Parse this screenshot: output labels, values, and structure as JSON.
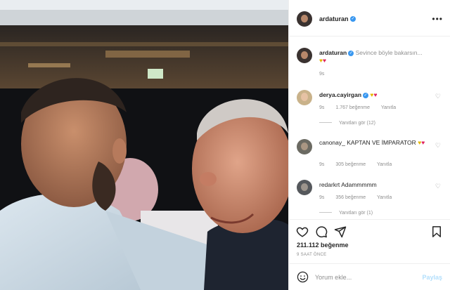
{
  "post": {
    "username": "ardaturan",
    "verified": true,
    "more_icon": "more-horizontal-icon"
  },
  "caption": {
    "username": "ardaturan",
    "text": "Sevince böyle bakarsın...",
    "emojis": [
      "yellow-heart",
      "red-heart"
    ],
    "time": "9s"
  },
  "comments": [
    {
      "username": "derya.cayirgan",
      "verified": true,
      "text": "",
      "emojis": [
        "yellow-heart",
        "red-heart"
      ],
      "time": "9s",
      "likes": "1.767 beğenme",
      "reply": "Yanıtla",
      "view_replies": "Yanıtları gör (12)"
    },
    {
      "username": "canonay_",
      "verified": false,
      "text": "KAPTAN VE İMPARATOR",
      "emojis": [
        "yellow-heart",
        "red-heart"
      ],
      "time": "9s",
      "likes": "305 beğenme",
      "reply": "Yanıtla",
      "view_replies": ""
    },
    {
      "username": "redarkrt",
      "verified": false,
      "text": "Adammmmm",
      "emojis": [],
      "time": "9s",
      "likes": "356 beğenme",
      "reply": "Yanıtla",
      "view_replies": "Yanıtları gör (1)"
    }
  ],
  "actions": {
    "like_icon": "heart-icon",
    "comment_icon": "comment-icon",
    "share_icon": "share-icon",
    "save_icon": "bookmark-icon",
    "likes": "211.112 beğenme",
    "time_ago": "9 SAAT ÖNCE"
  },
  "add_comment": {
    "emoji_icon": "smile-icon",
    "placeholder": "Yorum ekle...",
    "post_label": "Paylaş"
  },
  "colors": {
    "accent": "#3897f0",
    "post_disabled": "#b2dffc",
    "muted": "#8e8e8e",
    "heart_red": "#e0245e",
    "heart_yellow": "#e6b800"
  }
}
